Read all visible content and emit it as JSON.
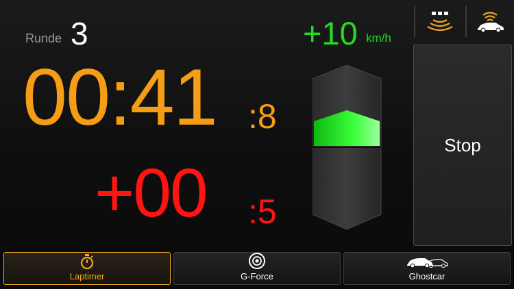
{
  "header": {
    "round_label": "Runde",
    "round_value": "3",
    "speed_delta": "+10",
    "speed_unit": "km/h"
  },
  "timer": {
    "lap_time": "00:41",
    "lap_tenths": ":8",
    "delta_time": "+00",
    "delta_tenths": ":5"
  },
  "indicator": {
    "direction": "up"
  },
  "status_icons": [
    "obd-signal-icon",
    "car-signal-icon"
  ],
  "actions": {
    "stop_label": "Stop"
  },
  "tabs": [
    {
      "label": "Laptimer",
      "icon": "stopwatch-icon",
      "active": true
    },
    {
      "label": "G-Force",
      "icon": "target-icon",
      "active": false
    },
    {
      "label": "Ghostcar",
      "icon": "cars-icon",
      "active": false
    }
  ],
  "colors": {
    "accent_orange": "#f59d16",
    "delta_red": "#ff1414",
    "speed_green": "#22dd22"
  }
}
